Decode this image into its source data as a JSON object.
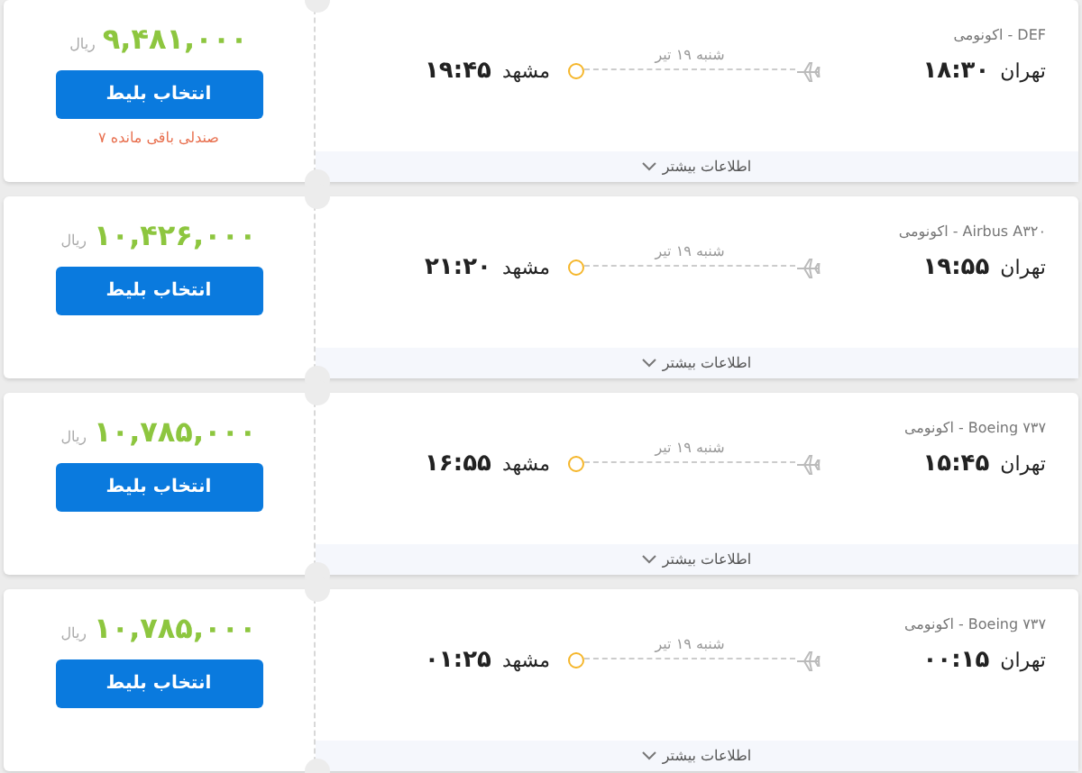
{
  "flights": [
    {
      "airline": "DEF - اکونومی",
      "origin": {
        "city": "تهران",
        "time": "۱۸:۳۰"
      },
      "destination": {
        "city": "مشهد",
        "time": "۱۹:۴۵"
      },
      "date": "شنبه ۱۹ تیر",
      "more": "اطلاعات بیشتر",
      "price": "۹,۴۸۱,۰۰۰",
      "currency": "ریال",
      "button": "انتخاب بلیط",
      "seats_left": "۷ صندلی باقی مانده"
    },
    {
      "airline": "Airbus A۳۲۰ - اکونومی",
      "origin": {
        "city": "تهران",
        "time": "۱۹:۵۵"
      },
      "destination": {
        "city": "مشهد",
        "time": "۲۱:۲۰"
      },
      "date": "شنبه ۱۹ تیر",
      "more": "اطلاعات بیشتر",
      "price": "۱۰,۴۲۶,۰۰۰",
      "currency": "ریال",
      "button": "انتخاب بلیط"
    },
    {
      "airline": "Boeing ۷۳۷ - اکونومی",
      "origin": {
        "city": "تهران",
        "time": "۱۵:۴۵"
      },
      "destination": {
        "city": "مشهد",
        "time": "۱۶:۵۵"
      },
      "date": "شنبه ۱۹ تیر",
      "more": "اطلاعات بیشتر",
      "price": "۱۰,۷۸۵,۰۰۰",
      "currency": "ریال",
      "button": "انتخاب بلیط"
    },
    {
      "airline": "Boeing ۷۳۷ - اکونومی",
      "origin": {
        "city": "تهران",
        "time": "۰۰:۱۵"
      },
      "destination": {
        "city": "مشهد",
        "time": "۰۱:۲۵"
      },
      "date": "شنبه ۱۹ تیر",
      "more": "اطلاعات بیشتر",
      "price": "۱۰,۷۸۵,۰۰۰",
      "currency": "ریال",
      "button": "انتخاب بلیط"
    }
  ]
}
